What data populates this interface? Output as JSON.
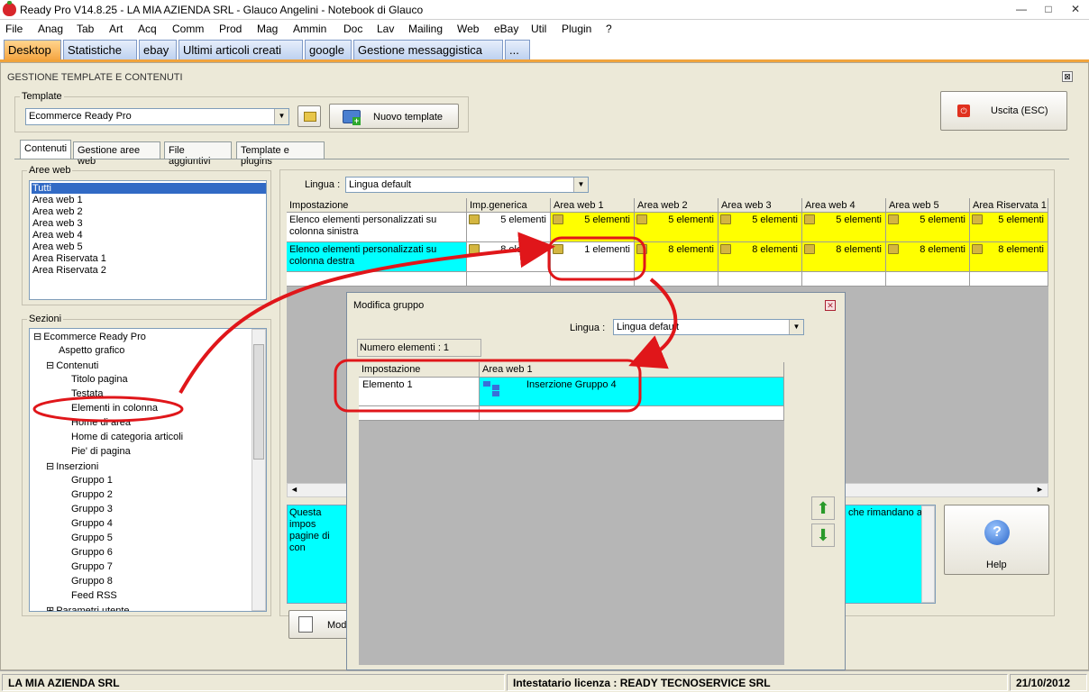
{
  "window": {
    "title": "Ready Pro V14.8.25 - LA MIA AZIENDA SRL - Glauco Angelini - Notebook di Glauco",
    "minimize": "—",
    "maximize": "□",
    "close": "✕"
  },
  "menu": [
    "File",
    "Anag",
    "Tab",
    "Art",
    "Acq",
    "Comm",
    "Prod",
    "Mag",
    "Ammin",
    "Doc",
    "Lav",
    "Mailing",
    "Web",
    "eBay",
    "Util",
    "Plugin",
    "?"
  ],
  "desktop_tabs": [
    "Desktop",
    "Statistiche",
    "ebay",
    "Ultimi articoli creati",
    "google",
    "Gestione messaggistica",
    "..."
  ],
  "panel": {
    "title": "GESTIONE TEMPLATE E CONTENUTI",
    "close": "⊠",
    "template_group": "Template",
    "template_value": "Ecommerce Ready Pro",
    "new_template_button": "Nuovo template",
    "exit_button": "Uscita (ESC)",
    "sub_tabs": [
      "Contenuti",
      "Gestione aree web",
      "File aggiuntivi",
      "Template e plugins"
    ],
    "areas_group": "Aree web",
    "areas": [
      "Tutti",
      "Area web 1",
      "Area web 2",
      "Area web 3",
      "Area web 4",
      "Area web 5",
      "Area Riservata 1",
      "Area Riservata 2"
    ],
    "sections_group": "Sezioni",
    "tree": [
      {
        "label": "Ecommerce Ready Pro",
        "level": 0,
        "toggle": "⊟"
      },
      {
        "label": "Aspetto grafico",
        "level": 1
      },
      {
        "label": "Contenuti",
        "level": 1,
        "toggle": "⊟"
      },
      {
        "label": "Titolo pagina",
        "level": 2
      },
      {
        "label": "Testata",
        "level": 2
      },
      {
        "label": "Elementi in colonna",
        "level": 2
      },
      {
        "label": "Home di area",
        "level": 2
      },
      {
        "label": "Home di categoria articoli",
        "level": 2
      },
      {
        "label": "Pie' di pagina",
        "level": 2
      },
      {
        "label": "Inserzioni",
        "level": 1,
        "toggle": "⊟"
      },
      {
        "label": "Gruppo 1",
        "level": 2
      },
      {
        "label": "Gruppo 2",
        "level": 2
      },
      {
        "label": "Gruppo 3",
        "level": 2
      },
      {
        "label": "Gruppo 4",
        "level": 2
      },
      {
        "label": "Gruppo 5",
        "level": 2
      },
      {
        "label": "Gruppo 6",
        "level": 2
      },
      {
        "label": "Gruppo 7",
        "level": 2
      },
      {
        "label": "Gruppo 8",
        "level": 2
      },
      {
        "label": "Feed RSS",
        "level": 2
      },
      {
        "label": "Parametri utente",
        "level": 1,
        "toggle": "⊞"
      }
    ],
    "lingua_label": "Lingua :",
    "lingua_value": "Lingua default",
    "grid": {
      "headers": [
        "Impostazione",
        "Imp.generica",
        "Area web 1",
        "Area web 2",
        "Area web 3",
        "Area web 4",
        "Area web 5",
        "Area Riservata 1"
      ],
      "rows": [
        {
          "label": "Elenco elementi personalizzati su colonna sinistra",
          "values": [
            "5 elementi",
            "5 elementi",
            "5 elementi",
            "5 elementi",
            "5 elementi",
            "5 elementi",
            "5 elementi"
          ]
        },
        {
          "label": "Elenco elementi personalizzati su colonna destra",
          "values": [
            "8 elementi",
            "1 elementi",
            "8 elementi",
            "8 elementi",
            "8 elementi",
            "8 elementi",
            "8 elementi"
          ]
        }
      ]
    },
    "description_left": "Questa impos pagine di con",
    "description_right": "che rimandano a",
    "modify_button": "Mod",
    "help_button": "Help"
  },
  "dialog": {
    "title": "Modifica gruppo",
    "close": "✕",
    "lingua_label": "Lingua :",
    "lingua_value": "Lingua default",
    "count_label": "Numero elementi : 1",
    "grid_headers": [
      "Impostazione",
      "Area web 1"
    ],
    "row_label": "Elemento 1",
    "row_value": "Inserzione Gruppo 4"
  },
  "status": {
    "company": "LA MIA AZIENDA SRL",
    "license": "Intestatario licenza : READY TECNOSERVICE SRL",
    "date": "21/10/2012"
  },
  "colors": {
    "accent_orange": "#f0a33c",
    "highlight_cyan": "#00ffff",
    "highlight_yellow": "#ffff00",
    "selection_blue": "#316ac5",
    "annotation_red": "#e0161a"
  }
}
